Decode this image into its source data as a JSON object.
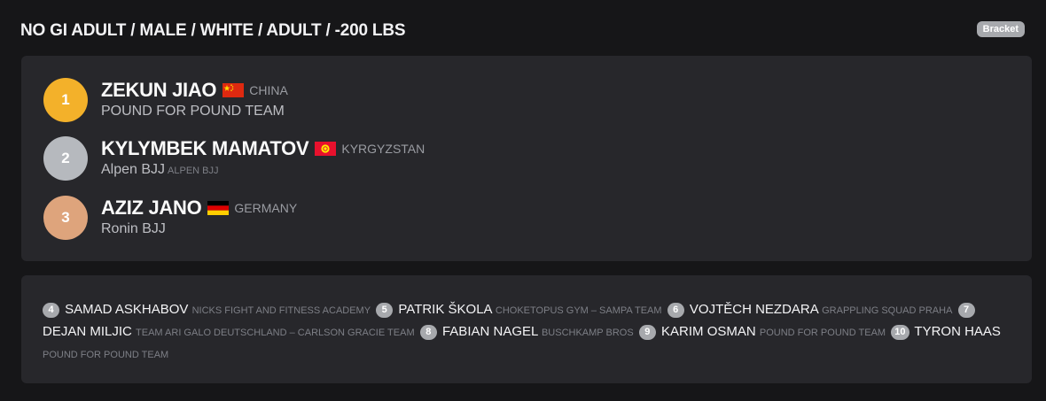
{
  "header": {
    "title": "NO GI ADULT / MALE / WHITE / ADULT / -200 LBS",
    "bracket_label": "Bracket"
  },
  "podium": [
    {
      "place": "1",
      "name": "ZEKUN JIAO",
      "country": "CHINA",
      "flag": "china-flag-icon",
      "team": "POUND FOR POUND TEAM",
      "team_sub": ""
    },
    {
      "place": "2",
      "name": "KYLYMBEK MAMATOV",
      "country": "KYRGYZSTAN",
      "flag": "kyrgyzstan-flag-icon",
      "team": "Alpen BJJ",
      "team_sub": "ALPEN BJJ"
    },
    {
      "place": "3",
      "name": "AZIZ JANO",
      "country": "GERMANY",
      "flag": "germany-flag-icon",
      "team": "Ronin BJJ",
      "team_sub": ""
    }
  ],
  "others": [
    {
      "place": "4",
      "name": "SAMAD ASKHABOV",
      "team": "NICKS FIGHT AND FITNESS ACADEMY"
    },
    {
      "place": "5",
      "name": "PATRIK ŠKOLA",
      "team": "CHOKETOPUS GYM – SAMPA TEAM"
    },
    {
      "place": "6",
      "name": "VOJTĚCH NEZDARA",
      "team": "GRAPPLING SQUAD PRAHA"
    },
    {
      "place": "7",
      "name": "DEJAN MILJIC",
      "team": "TEAM ARI GALO DEUTSCHLAND – CARLSON GRACIE TEAM"
    },
    {
      "place": "8",
      "name": "FABIAN NAGEL",
      "team": "BUSCHKAMP BROS"
    },
    {
      "place": "9",
      "name": "KARIM OSMAN",
      "team": "POUND FOR POUND TEAM"
    },
    {
      "place": "10",
      "name": "TYRON HAAS",
      "team": "POUND FOR POUND TEAM"
    }
  ],
  "colors": {
    "background": "#161618",
    "card": "#27272b",
    "gold": "#f3b12a",
    "silver": "#b6b9be",
    "bronze": "#dea47c",
    "badge": "#a7a9ad"
  }
}
